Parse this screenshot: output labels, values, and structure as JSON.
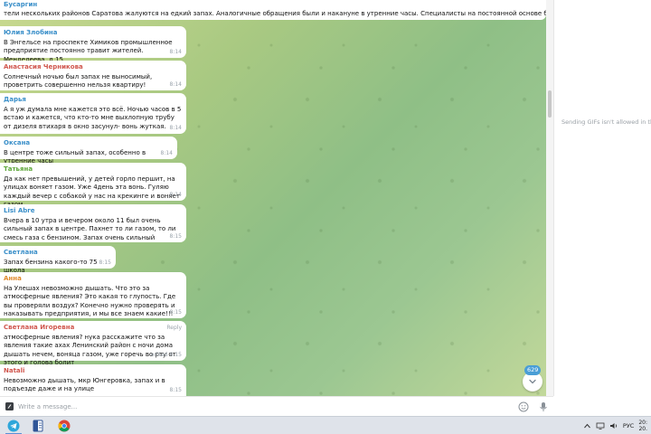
{
  "chat": {
    "top_message": {
      "sender": "Бусаргин",
      "text": "тели нескольких районов Саратова жалуются на едкий запах. Аналогичные обращения были и накануне в утренние часы.   Специалисты на постоянной основе берут пробы воздуха и анализируют ..."
    },
    "messages": [
      {
        "sender": "Юлия Злобина",
        "color": "#3a8fc9",
        "text": "В Энгельсе на проспекте Химиков промышленное предприятие постоянно травит жителей. Менделеева, д.15",
        "time": "8:14"
      },
      {
        "sender": "Анастасия Черникова",
        "color": "#d0564d",
        "text": "Солнечный ночью был запах не выносимый, проветрить совершенно нельзя квартиру!",
        "time": "8:14"
      },
      {
        "sender": "Дарья",
        "color": "#3a8fc9",
        "text": "А я уж думала мне кажется это всё. Ночью часов в 5 встаю и кажется, что кто-то мне выхлопную трубу от дизеля втихаря в окно засунул- вонь жуткая.",
        "time": "8:14"
      },
      {
        "sender": "Оксана",
        "color": "#3a8fc9",
        "text": "В центре тоже сильный запах, особенно в утренние часы",
        "time": "8:14"
      },
      {
        "sender": "Татьяна",
        "color": "#5fa83c",
        "text": "Да как нет превышений, у детей горло першит, на улицах воняет газом. Уже 4день эта вонь. Гуляю каждый вечер с собакой у нас на крекинге и воняет газом.",
        "time": "8:14"
      },
      {
        "sender": "Lisi Abre",
        "color": "#3a8fc9",
        "text": "Вчера в 10 утра и вечером около 11 был очень сильный запах в центре. Пахнет то ли газом, то ли смесь газа с бензином. Запах очень сильный",
        "time": "8:15"
      },
      {
        "sender": "Светлана",
        "color": "#3a8fc9",
        "text": "Запах бензина какого-то 75 школа",
        "time": "8:15"
      },
      {
        "sender": "Анна",
        "color": "#e08a2c",
        "text": "На Улешах невозможно дышать. Что это за атмосферные явления? Это какая то глупость. Где вы проверяли воздух? Конечно нужно проверять и наказывать предприятия, и мы все знаем какие!!!",
        "time": "8:15"
      },
      {
        "sender": "Светлана Игоревна",
        "color": "#d0564d",
        "text": "атмосферные явления? нука расскажите что за явления такие ахах Ленинский район с ночи дома дышать нечем, воняца газом, уже горечь во рту от этого и голова болит",
        "time": "edited 8:15",
        "reply": "Reply"
      },
      {
        "sender": "Natali",
        "color": "#d0564d",
        "text": "Невозможно дышать, мкр Юнгеровка, запах и в подъезде даже и на улице",
        "time": "8:15"
      }
    ],
    "unread_count": "629"
  },
  "side_panel": {
    "notice": "Sending GIFs isn't allowed in this gr"
  },
  "composer": {
    "placeholder": "Write a message..."
  },
  "taskbar": {
    "apps": [
      "telegram-icon",
      "document-icon",
      "chrome-icon"
    ],
    "language": "РУС",
    "clock_line1": "20:",
    "clock_line2": "20."
  }
}
